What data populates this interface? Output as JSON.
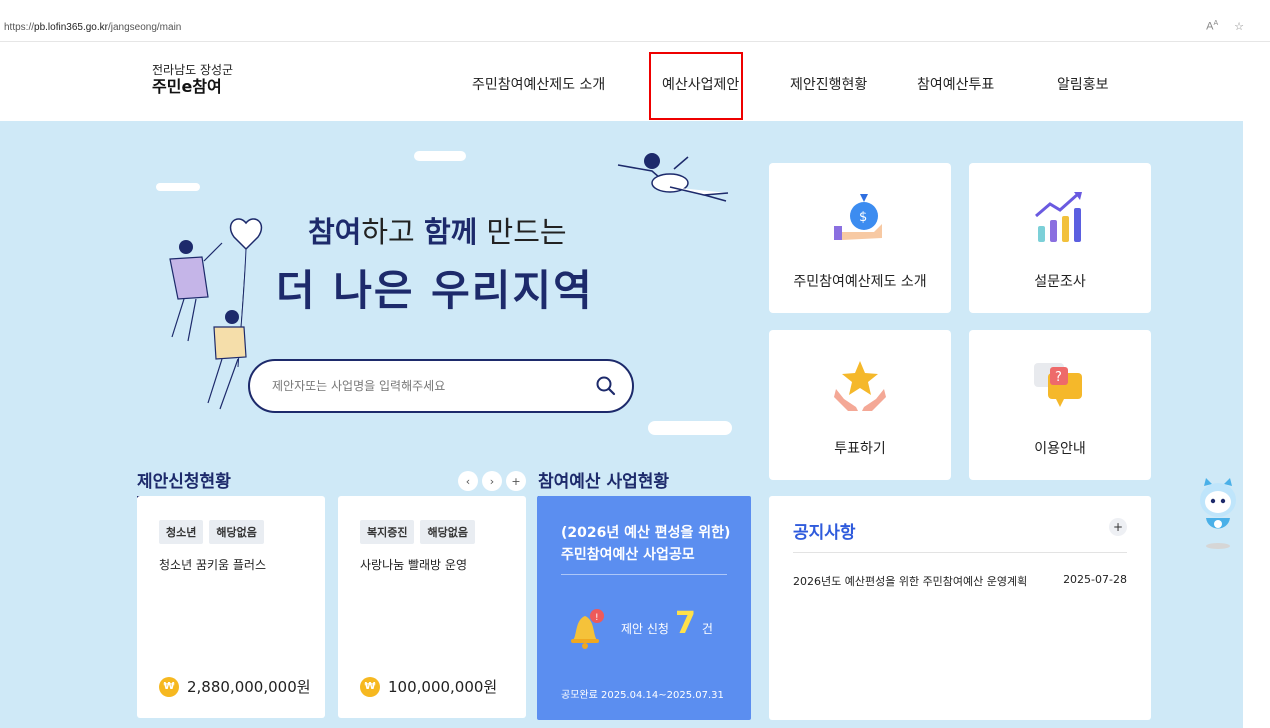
{
  "browser": {
    "url_prefix": "https://",
    "url_host": "pb.lofin365.go.kr",
    "url_path": "/jangseong/main",
    "read_aloud_icon": "read-aloud-icon",
    "favorite_icon": "favorite-star-icon"
  },
  "header": {
    "org": "전라남도 장성군",
    "site_name": "주민e참여",
    "nav": [
      "주민참여예산제도 소개",
      "예산사업제안",
      "제안진행현황",
      "참여예산투표",
      "알림홍보"
    ]
  },
  "hero": {
    "line1_a": "참여",
    "line1_b": "하고 ",
    "line1_c": "함께",
    "line1_d": " 만드는",
    "line2": "더 나은 우리지역",
    "search_placeholder": "제안자또는 사업명을 입력해주세요",
    "search_icon": "search-icon"
  },
  "tiles": [
    {
      "label": "주민참여예산제도 소개",
      "icon": "money-bag-hand-icon"
    },
    {
      "label": "설문조사",
      "icon": "bar-chart-up-icon"
    },
    {
      "label": "투표하기",
      "icon": "star-hands-icon"
    },
    {
      "label": "이용안내",
      "icon": "question-speech-bubble-icon"
    }
  ],
  "proposals": {
    "title": "제안신청현황",
    "pager": [
      "‹",
      "›",
      "+"
    ],
    "cards": [
      {
        "tags": [
          "청소년",
          "해당없음"
        ],
        "title": "청소년 꿈키움 플러스",
        "amount": "2,880,000,000원"
      },
      {
        "tags": [
          "복지증진",
          "해당없음"
        ],
        "title": "사랑나눔 빨래방 운영",
        "amount": "100,000,000원"
      }
    ],
    "coin_symbol": "₩"
  },
  "budget": {
    "title": "참여예산 사업현황",
    "box_line1": "(2026년 예산 편성을 위한)",
    "box_line2": "주민참여예산 사업공모",
    "count_label": "제안 신청",
    "count": "7",
    "count_unit": "건",
    "period": "공모완료  2025.04.14~2025.07.31",
    "bell_icon": "bell-icon"
  },
  "notice": {
    "title": "공지사항",
    "more": "+",
    "items": [
      {
        "title": "2026년도 예산편성을 위한 주민참여예산 운영계획",
        "date": "2025-07-28"
      }
    ]
  }
}
